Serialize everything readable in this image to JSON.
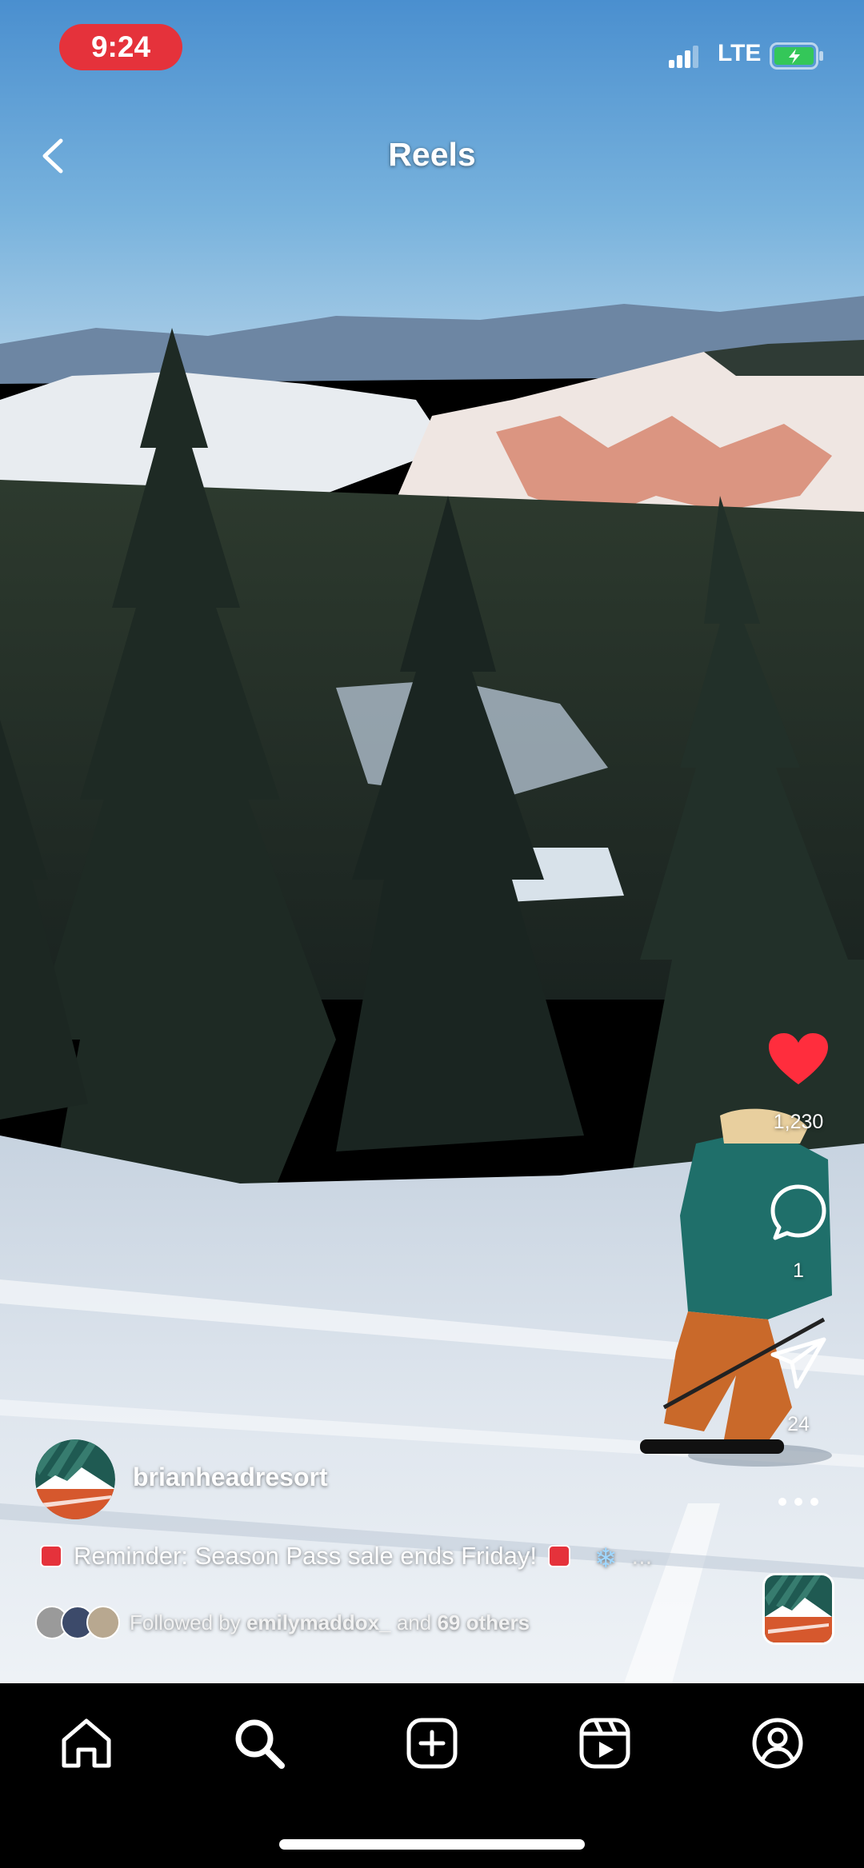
{
  "status_bar": {
    "time": "9:24",
    "network": "LTE",
    "accent_color": "#e5323b",
    "battery_color": "#34c759"
  },
  "header": {
    "title": "Reels",
    "back_icon": "chevron-left-icon"
  },
  "actions": {
    "like_count": "1,230",
    "comment_count": "1",
    "share_count": "24",
    "like_color": "#ff2d3d",
    "more_icon": "more-horizontal-icon"
  },
  "post": {
    "username": "brianheadresort",
    "caption_text": "Reminder: Season Pass sale ends Friday!",
    "caption_more": "...",
    "followed_prefix": "Followed by",
    "followed_user": "emilymaddox_",
    "followed_middle": "and",
    "followed_others": "69 others"
  },
  "nav": {
    "items": [
      "home-icon",
      "search-icon",
      "create-icon",
      "reels-icon",
      "profile-icon"
    ]
  }
}
